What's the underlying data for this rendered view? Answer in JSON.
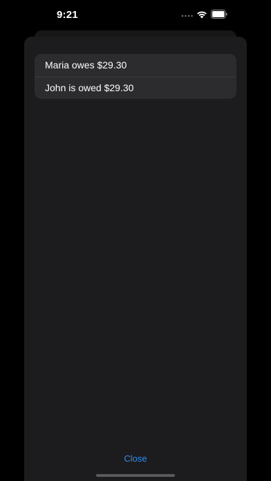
{
  "status_bar": {
    "time": "9:21"
  },
  "balances": [
    {
      "text": "Maria owes $29.30"
    },
    {
      "text": "John is owed $29.30"
    }
  ],
  "actions": {
    "close_label": "Close"
  },
  "colors": {
    "accent": "#2f8bf2",
    "sheet_background": "#1c1c1e",
    "list_background": "#2c2c2e"
  }
}
